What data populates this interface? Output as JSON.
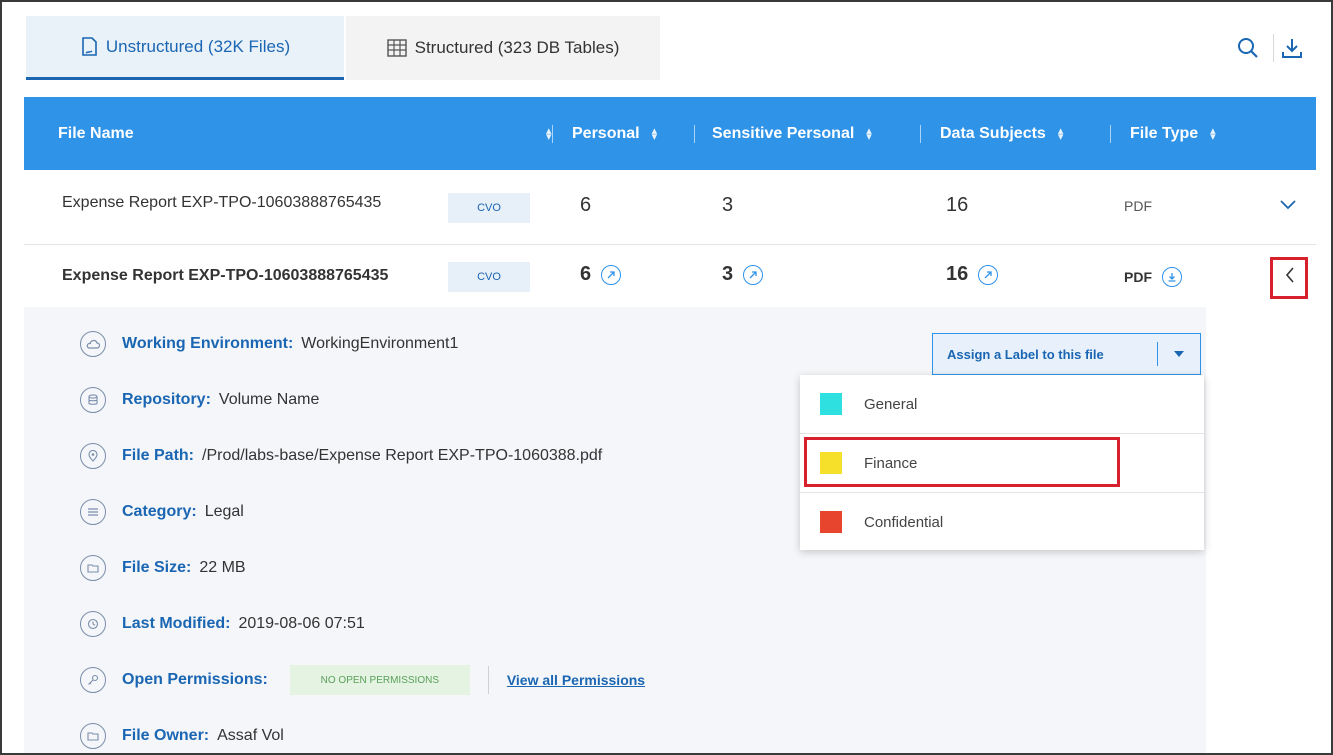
{
  "tabs": [
    {
      "label": "Unstructured (32K Files)",
      "active": true
    },
    {
      "label": "Structured (323 DB Tables)",
      "active": false
    }
  ],
  "table": {
    "columns": [
      "File Name",
      "Personal",
      "Sensitive Personal",
      "Data Subjects",
      "File Type"
    ],
    "rows": [
      {
        "file_name": "Expense Report EXP-TPO-10603888765435",
        "tag": "CVO",
        "personal": "6",
        "sensitive": "3",
        "subjects": "16",
        "file_type": "PDF"
      },
      {
        "file_name": "Expense Report EXP-TPO-10603888765435",
        "tag": "CVO",
        "personal": "6",
        "sensitive": "3",
        "subjects": "16",
        "file_type": "PDF"
      }
    ]
  },
  "details": {
    "working_env_label": "Working Environment:",
    "working_env_value": "WorkingEnvironment1",
    "repository_label": "Repository:",
    "repository_value": "Volume Name",
    "file_path_label": "File Path:",
    "file_path_value": "/Prod/labs-base/Expense Report EXP-TPO-1060388.pdf",
    "category_label": "Category:",
    "category_value": "Legal",
    "file_size_label": "File Size:",
    "file_size_value": "22 MB",
    "last_modified_label": "Last Modified:",
    "last_modified_value": "2019-08-06 07:51",
    "open_permissions_label": "Open Permissions:",
    "open_permissions_badge": "NO OPEN PERMISSIONS",
    "view_permissions_link": "View all Permissions",
    "file_owner_label": "File Owner:",
    "file_owner_value": "Assaf Vol"
  },
  "assign_label": {
    "button": "Assign a Label to this file",
    "options": [
      {
        "label": "General",
        "color": "#2ee0e0"
      },
      {
        "label": "Finance",
        "color": "#f7e02a"
      },
      {
        "label": "Confidential",
        "color": "#e8452f"
      }
    ]
  },
  "colors": {
    "header_blue": "#2f93e8",
    "accent_blue": "#1a66b3",
    "highlight_red": "#d6202b"
  }
}
